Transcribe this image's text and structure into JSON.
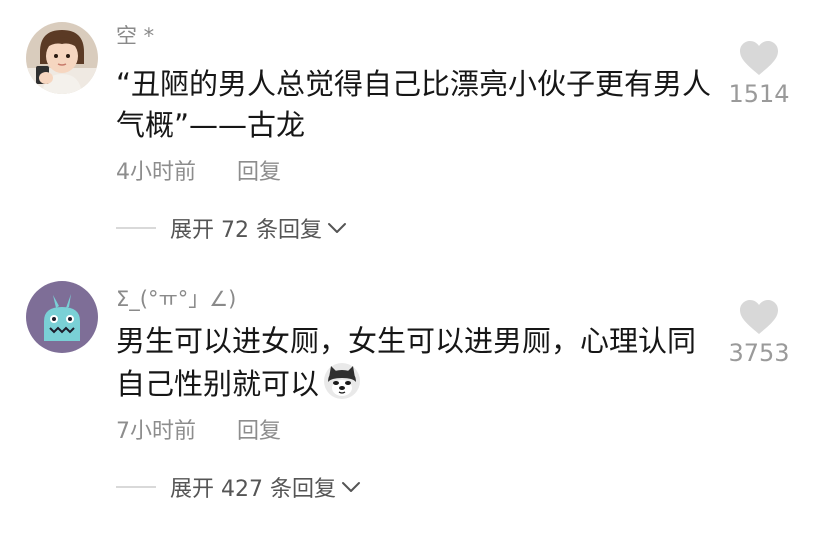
{
  "comments": [
    {
      "username": "空 *",
      "text": "“丑陋的男人总觉得自己比漂亮小伙子更有男人气概”——古龙",
      "time": "4小时前",
      "reply_label": "回复",
      "likes": "1514",
      "expand_prefix": "展开",
      "expand_count": "72",
      "expand_suffix": "条回复"
    },
    {
      "username": "Σ_(°ㅠ°」∠)",
      "text": "男生可以进女厕，女生可以进男厕，心理认同自己性别就可以",
      "emoji": "doge-emoji",
      "time": "7小时前",
      "reply_label": "回复",
      "likes": "3753",
      "expand_prefix": "展开",
      "expand_count": "427",
      "expand_suffix": "条回复"
    }
  ],
  "colors": {
    "text": "#161616",
    "secondary": "#8d8d8d",
    "expand": "#555555",
    "heart": "#d8d8d8",
    "avatar2_bg": "#7e6e97"
  }
}
